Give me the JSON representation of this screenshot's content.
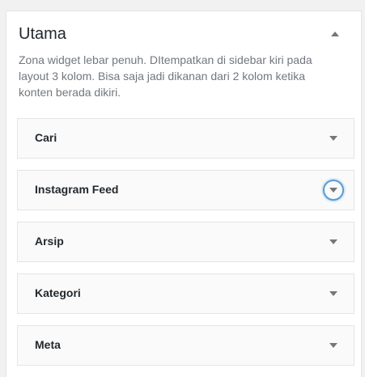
{
  "panel": {
    "title": "Utama",
    "description": "Zona widget lebar penuh. DItempatkan di sidebar kiri pada layout 3 kolom. Bisa saja jadi dikanan dari 2 kolom ketika konten berada dikiri.",
    "toggle_icon": "triangle-up-icon"
  },
  "widgets": [
    {
      "label": "Cari",
      "arrow_icon": "triangle-down-icon",
      "focused": false
    },
    {
      "label": "Instagram Feed",
      "arrow_icon": "triangle-down-icon",
      "focused": true
    },
    {
      "label": "Arsip",
      "arrow_icon": "triangle-down-icon",
      "focused": false
    },
    {
      "label": "Kategori",
      "arrow_icon": "triangle-down-icon",
      "focused": false
    },
    {
      "label": "Meta",
      "arrow_icon": "triangle-down-icon",
      "focused": false
    }
  ],
  "colors": {
    "title": "#23282d",
    "description": "#72777c",
    "arrow": "#72777c",
    "focus_ring": "#5b9dd9",
    "widget_background": "#fafafa",
    "border": "#e2e4e7"
  }
}
